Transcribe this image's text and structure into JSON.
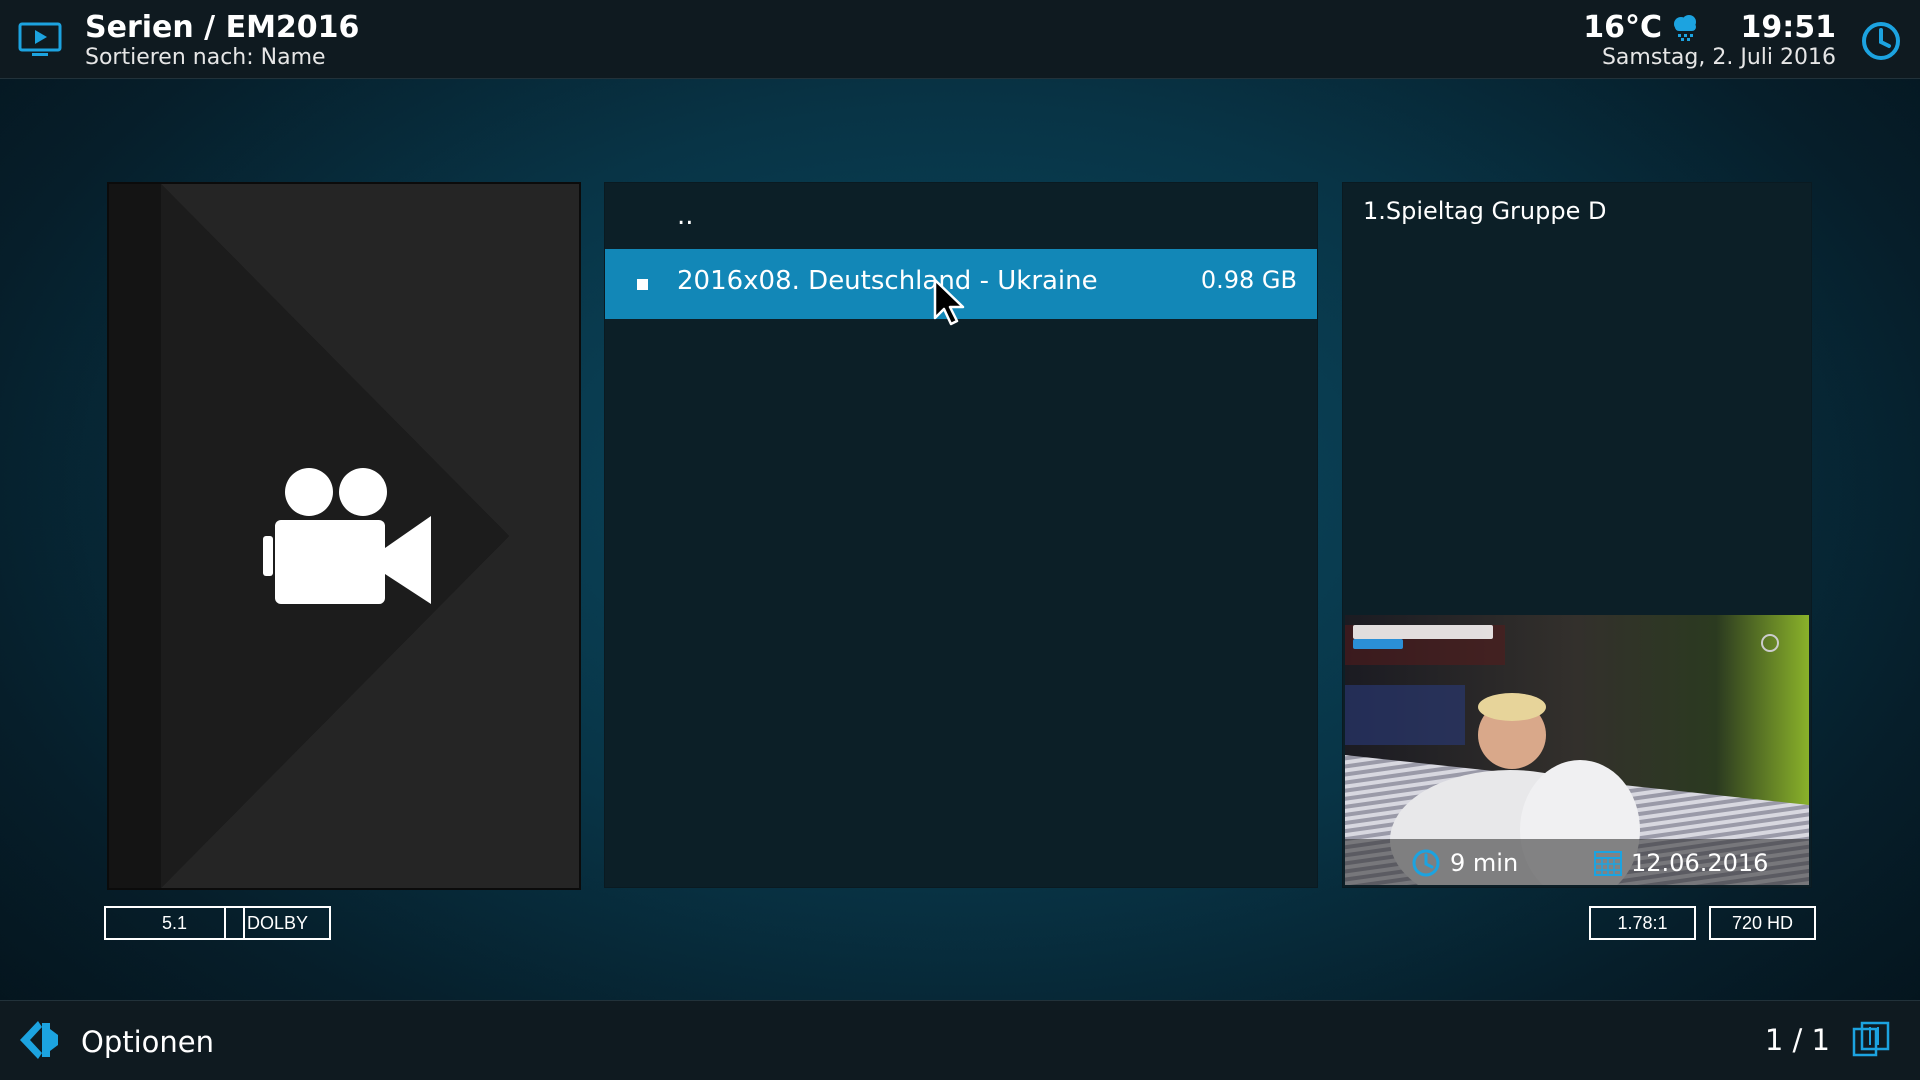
{
  "header": {
    "title": "Serien / EM2016",
    "subtitle": "Sortieren nach: Name",
    "temperature": "16°C",
    "weather_icon": "rain-cloud-icon",
    "time": "19:51",
    "date": "Samstag, 2. Juli 2016"
  },
  "list": {
    "parent_label": "..",
    "items": [
      {
        "label": "2016x08. Deutschland - Ukraine",
        "size": "0.98 GB",
        "selected": true
      }
    ]
  },
  "info": {
    "plot": "1.Spieltag Gruppe D",
    "duration": "9 min",
    "aired": "12.06.2016"
  },
  "badges": {
    "audio_channels": "5.1",
    "audio_codec": "DOLBY",
    "aspect_ratio": "1.78:1",
    "resolution": "720 HD"
  },
  "footer": {
    "options_label": "Optionen",
    "page_info": "1 / 1"
  },
  "colors": {
    "accent": "#1287b7",
    "icon_blue": "#1ca3e0",
    "bar_bg": "#0f1a20",
    "panel_bg": "#0c1f27"
  }
}
